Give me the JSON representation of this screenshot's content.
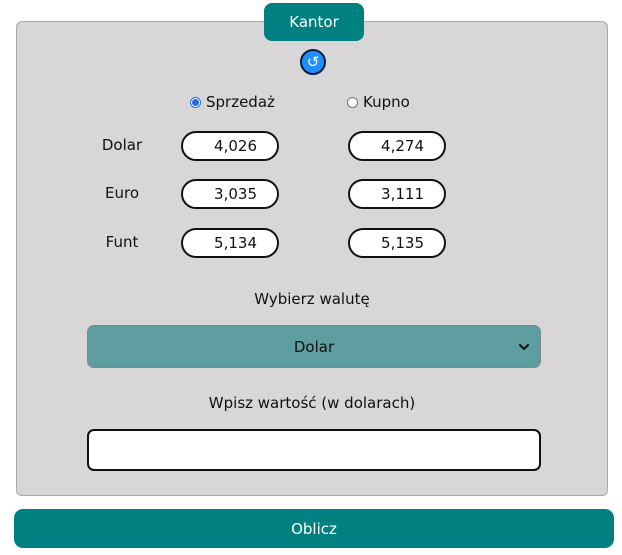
{
  "app": {
    "title": "Kantor"
  },
  "mode": {
    "options": [
      {
        "label": "Sprzedaż",
        "checked": true
      },
      {
        "label": "Kupno",
        "checked": false
      }
    ]
  },
  "rates": [
    {
      "currency": "Dolar",
      "sell": "4,026",
      "buy": "4,274"
    },
    {
      "currency": "Euro",
      "sell": "3,035",
      "buy": "3,111"
    },
    {
      "currency": "Funt",
      "sell": "5,134",
      "buy": "5,135"
    }
  ],
  "currency_select": {
    "label": "Wybierz walutę",
    "selected": "Dolar"
  },
  "amount_input": {
    "label": "Wpisz wartość (w dolarach)",
    "value": ""
  },
  "actions": {
    "calculate_label": "Oblicz"
  },
  "icons": {
    "refresh": "refresh-icon",
    "dropdown": "chevron-down-icon"
  },
  "colors": {
    "primary": "#008080",
    "select_bg": "#5f9ea0",
    "panel_bg": "#d8d6d7",
    "refresh_bg": "#1e90ff"
  }
}
